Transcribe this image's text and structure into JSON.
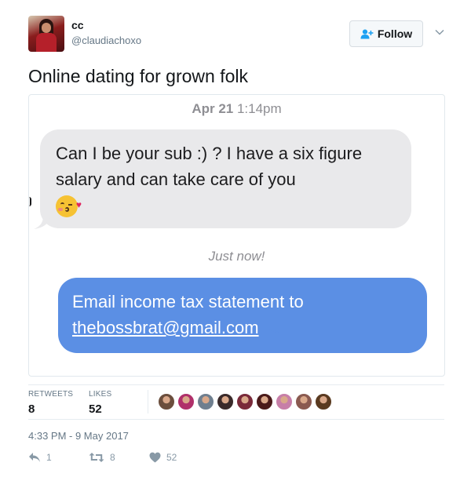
{
  "user": {
    "display_name": "cc",
    "handle": "@claudiachoxo",
    "follow_label": "Follow"
  },
  "tweet": {
    "text": "Online dating for grown folk"
  },
  "screenshot": {
    "stamp_date": "Apr 21",
    "stamp_time": "1:14pm",
    "incoming_message": "Can I be your sub :) ? I have a six figure salary and can take care of you",
    "incoming_emoji": "kissing-face-with-heart-emoji",
    "stamp_now": "Just now!",
    "outgoing_message_prefix": "Email income tax statement to",
    "outgoing_message_link": "thebossbrat@gmail.com"
  },
  "stats": {
    "retweets_label": "RETWEETS",
    "retweets_count": "8",
    "likes_label": "LIKES",
    "likes_count": "52"
  },
  "likers": [
    "#6b4e3d",
    "#b0306a",
    "#6f7f8f",
    "#3a2a2a",
    "#7a2a3a",
    "#4a1a1a",
    "#c77fa8",
    "#8a5a50",
    "#5a3a20"
  ],
  "timestamp": "4:33 PM - 9 May 2017",
  "actions": {
    "reply_count": "1",
    "retweet_count": "8",
    "like_count": "52"
  },
  "colors": {
    "outgoing_bubble": "#5b8fe4",
    "incoming_bubble": "#e9e9eb",
    "follow_icon": "#1da1f2"
  }
}
